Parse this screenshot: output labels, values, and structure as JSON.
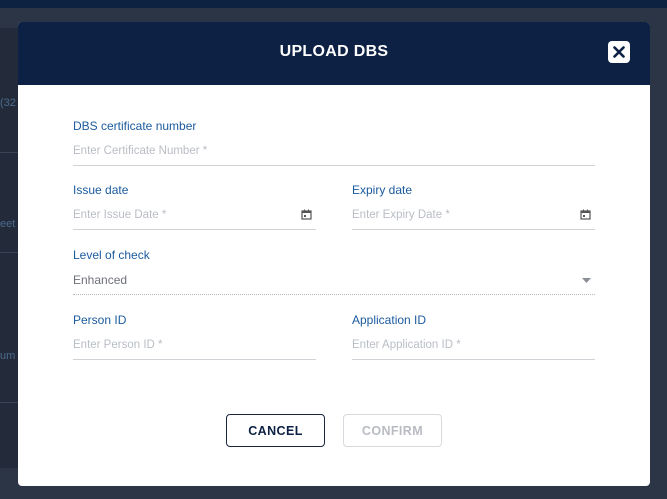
{
  "background": {
    "fragments": [
      "(32",
      "eet",
      "um"
    ]
  },
  "dialog": {
    "title": "UPLOAD DBS",
    "close_icon": "close-icon",
    "fields": {
      "certificate": {
        "label": "DBS certificate number",
        "placeholder": "Enter Certificate Number *",
        "value": ""
      },
      "issue_date": {
        "label": "Issue date",
        "placeholder": "Enter Issue Date *",
        "value": "",
        "icon": "calendar-icon"
      },
      "expiry_date": {
        "label": "Expiry date",
        "placeholder": "Enter Expiry Date *",
        "value": "",
        "icon": "calendar-icon"
      },
      "level_of_check": {
        "label": "Level of check",
        "selected": "Enhanced",
        "icon": "dropdown-caret-icon"
      },
      "person_id": {
        "label": "Person ID",
        "placeholder": "Enter Person ID *",
        "value": ""
      },
      "application_id": {
        "label": "Application ID",
        "placeholder": "Enter Application ID *",
        "value": ""
      }
    },
    "buttons": {
      "cancel": "CANCEL",
      "confirm": "CONFIRM"
    }
  },
  "colors": {
    "header": "#0d2144",
    "label": "#1a5a9e",
    "backdrop": "#2c3546"
  }
}
